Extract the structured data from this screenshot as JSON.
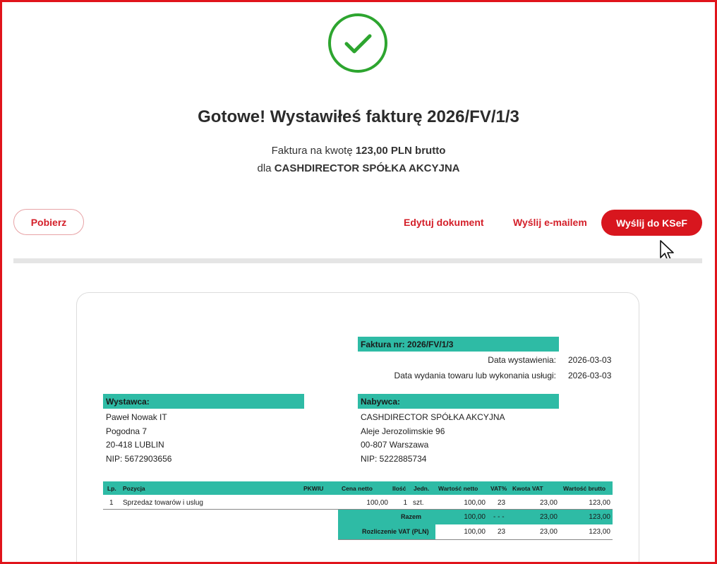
{
  "header": {
    "title": "Gotowe! Wystawiłeś fakturę 2026/FV/1/3",
    "amount_prefix": "Faktura na kwotę ",
    "amount": "123,00 PLN brutto",
    "recipient_prefix": "dla ",
    "recipient": "CASHDIRECTOR SPÓŁKA AKCYJNA"
  },
  "actions": {
    "download": "Pobierz",
    "edit": "Edytuj dokument",
    "email": "Wyślij e-mailem",
    "ksef": "Wyślij do KSeF"
  },
  "colors": {
    "accent": "#d8161e",
    "teal": "#2ebba5",
    "success": "#2da52f"
  },
  "invoice": {
    "number_label": "Faktura nr: 2026/FV/1/3",
    "issue_date_label": "Data wystawienia:",
    "issue_date": "2026-03-03",
    "delivery_date_label": "Data wydania towaru lub wykonania usługi:",
    "delivery_date": "2026-03-03",
    "seller": {
      "heading": "Wystawca:",
      "name": "Paweł Nowak IT",
      "street": "Pogodna 7",
      "city": "20-418 LUBLIN",
      "nip": "NIP: 5672903656"
    },
    "buyer": {
      "heading": "Nabywca:",
      "name": "CASHDIRECTOR SPÓŁKA AKCYJNA",
      "street": "Aleje Jerozolimskie 96",
      "city": "00-807 Warszawa",
      "nip": "NIP: 5222885734"
    },
    "table": {
      "headers": [
        "Lp.",
        "Pozycja",
        "PKWIU",
        "Cena netto",
        "Ilość",
        "Jedn.",
        "Wartość netto",
        "VAT%",
        "Kwota VAT",
        "Wartość brutto"
      ],
      "rows": [
        {
          "lp": "1",
          "item": "Sprzedaz towarów i uslug",
          "pkwiu": "",
          "price": "100,00",
          "qty": "1",
          "unit": "szt.",
          "net": "100,00",
          "vat_pct": "23",
          "vat_amt": "23,00",
          "gross": "123,00"
        }
      ],
      "total": {
        "label": "Razem",
        "net": "100,00",
        "vat_pct": "- - -",
        "vat_amt": "23,00",
        "gross": "123,00"
      },
      "vat_summary": {
        "label": "Rozliczenie VAT (PLN)",
        "net": "100,00",
        "vat_pct": "23",
        "vat_amt": "23,00",
        "gross": "123,00"
      }
    }
  }
}
